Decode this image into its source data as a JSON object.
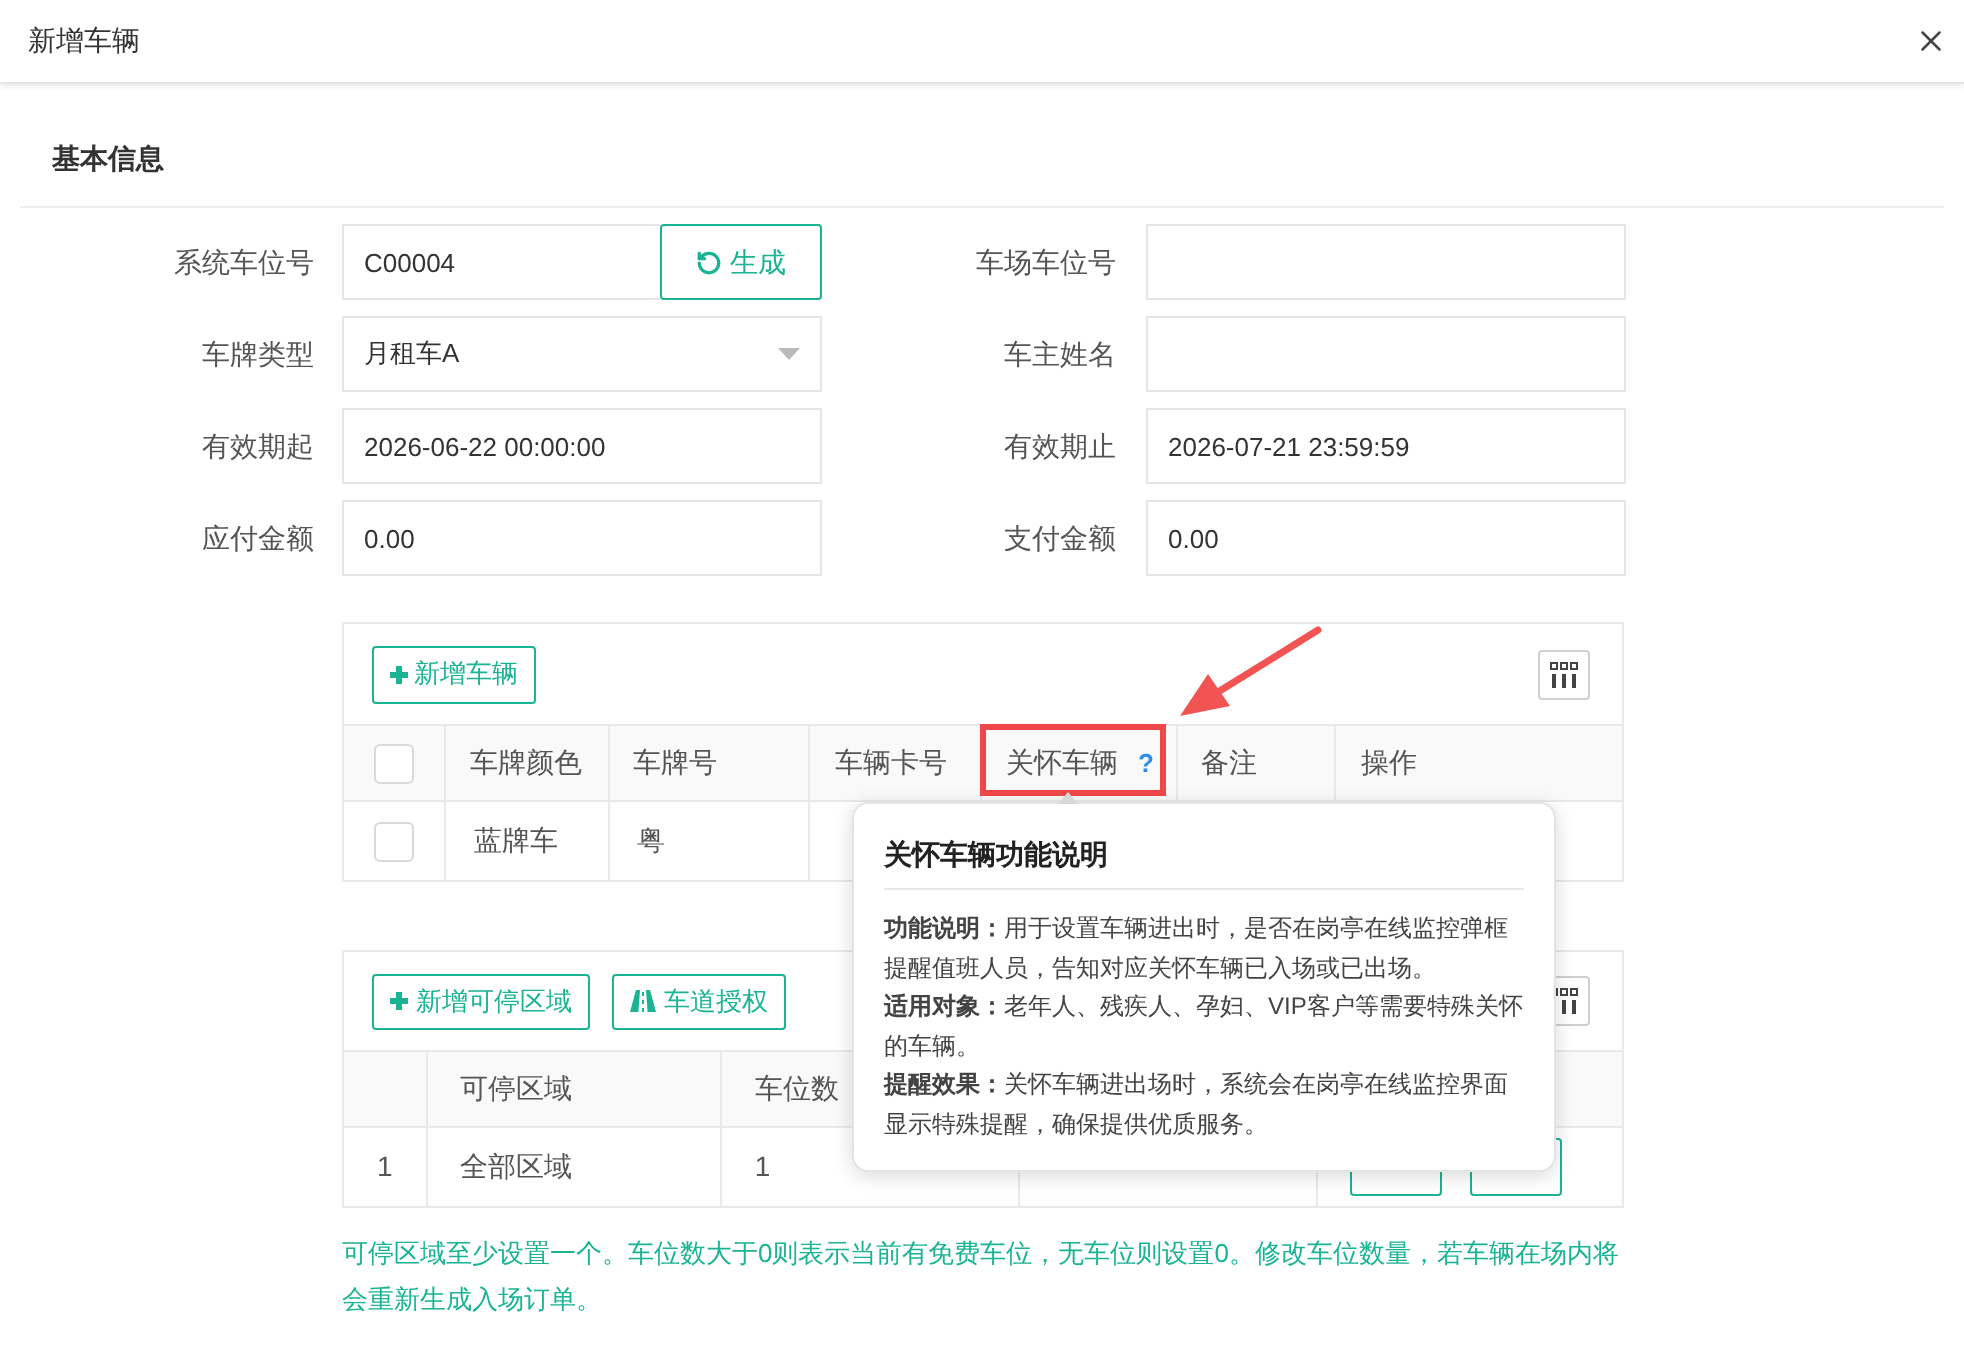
{
  "dialog": {
    "title": "新增车辆"
  },
  "section_title": "基本信息",
  "fields": [
    {
      "label": "系统车位号",
      "kind": "generate",
      "value": "C00004",
      "button": "生成"
    },
    {
      "label": "车场车位号",
      "kind": "text"
    },
    {
      "label": "车牌类型",
      "kind": "select",
      "value": "月租车A"
    },
    {
      "label": "车主姓名",
      "kind": "text"
    },
    {
      "label": "有效期起",
      "kind": "text",
      "value": "2026-06-22 00:00:00"
    },
    {
      "label": "有效期止",
      "kind": "text",
      "value": "2026-07-21 23:59:59"
    },
    {
      "label": "应付金额",
      "kind": "text",
      "value": "0.00"
    },
    {
      "label": "支付金额",
      "kind": "text",
      "value": "0.00"
    }
  ],
  "vehicle_table": {
    "add_button": "新增车辆",
    "select_all_checked": false,
    "columns": [
      {
        "label": "车牌颜色"
      },
      {
        "label": "车牌号"
      },
      {
        "label": "车辆卡号"
      },
      {
        "label": "关怀车辆",
        "help": "?",
        "highlighted": true
      },
      {
        "label": "备注"
      },
      {
        "label": "操作"
      }
    ],
    "rows": [
      {
        "checked": false,
        "cells": [
          "蓝牌车",
          "粤"
        ]
      }
    ]
  },
  "tooltip": {
    "title": "关怀车辆功能说明",
    "paragraphs": [
      "**功能说明：**用于设置车辆进出时，是否在岗亭在线监控弹框提醒值班人员，告知对应关怀车辆已入场或已出场。",
      "**适用对象：**老年人、残疾人、孕妇、VIP客户等需要特殊关怀的车辆。",
      "**提醒效果：**关怀车辆进出场时，系统会在岗亭在线监控界面显示特殊提醒，确保提供优质服务。"
    ]
  },
  "zone_table": {
    "buttons": [
      {
        "kind": "add",
        "label": "新增可停区域"
      },
      {
        "kind": "road",
        "label": "车道授权"
      }
    ],
    "columns": [
      "",
      "可停区域",
      "车位数"
    ],
    "rows": [
      {
        "cells": [
          "1",
          "全部区域",
          "1"
        ]
      }
    ]
  },
  "note": "可停区域至少设置一个。车位数大于0则表示当前有免费车位，无车位则设置0。修改车位数量，若车辆在场内将会重新生成入场订单。"
}
